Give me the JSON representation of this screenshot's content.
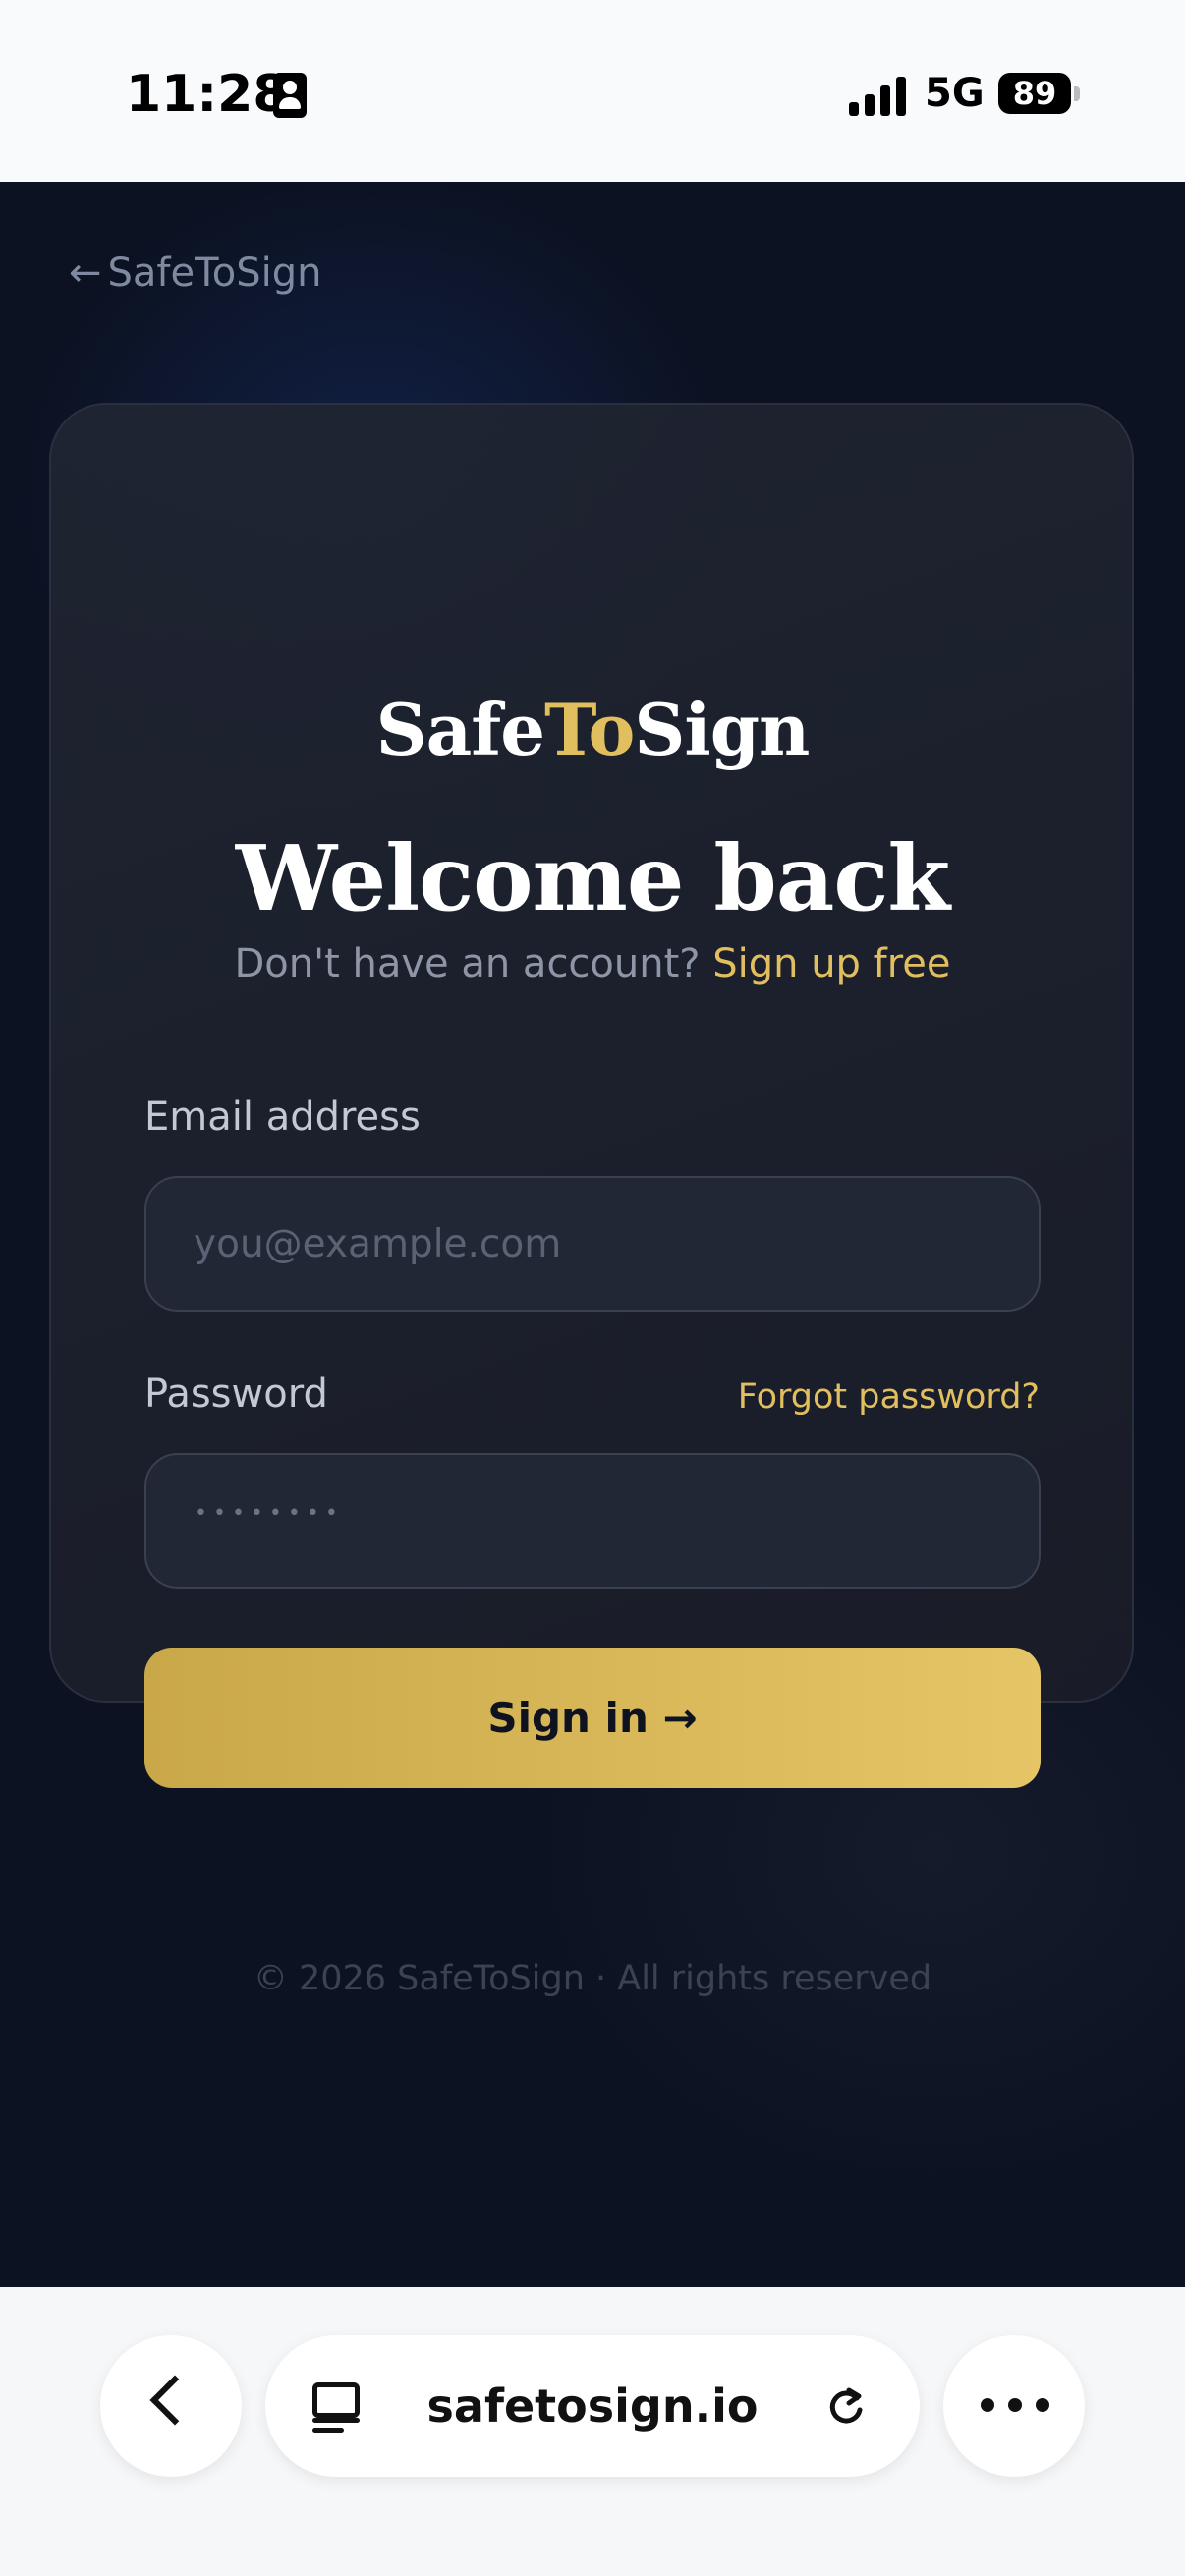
{
  "status_bar": {
    "time": "11:28",
    "network": "5G",
    "battery": "89"
  },
  "nav": {
    "back_arrow": "←",
    "back_label": "SafeToSign"
  },
  "brand": {
    "part1": "Safe",
    "part2": "To",
    "part3": "Sign"
  },
  "card": {
    "heading": "Welcome back",
    "subtitle_text": "Don't have an account?",
    "signup_link": "Sign up free"
  },
  "form": {
    "email_label": "Email address",
    "email_placeholder": "you@example.com",
    "email_value": "",
    "password_label": "Password",
    "password_placeholder": "••••••••",
    "forgot_link": "Forgot password?",
    "submit_label": "Sign in →"
  },
  "footer": {
    "text": "© 2026 SafeToSign · All rights reserved"
  },
  "browser": {
    "url": "safetosign.io"
  },
  "icons": {
    "back": "chevron-left-icon",
    "tabs": "tabs-icon",
    "reload": "reload-icon",
    "more": "more-icon",
    "id_card": "id-card-icon",
    "signal": "signal-icon",
    "battery": "battery-icon"
  },
  "colors": {
    "background": "#0c1222",
    "accent_gold": "#e2bf5e",
    "card": "#1e2230",
    "input": "#222736"
  }
}
